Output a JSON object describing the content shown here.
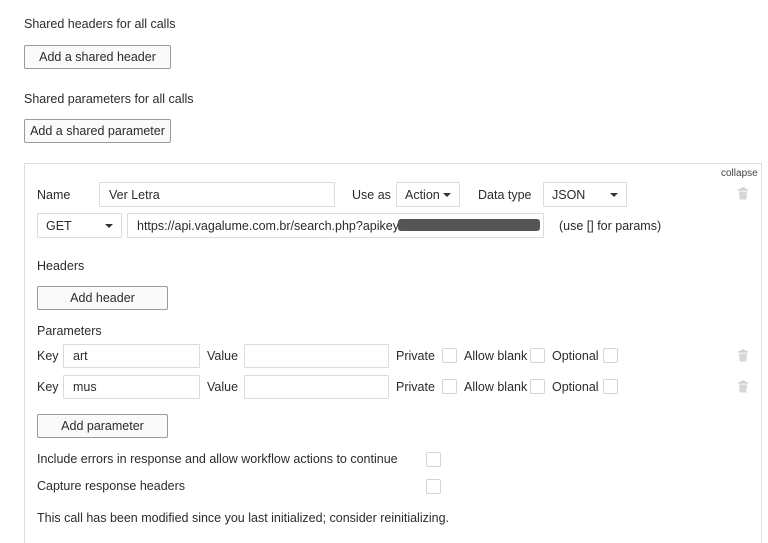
{
  "shared_headers": {
    "title": "Shared headers for all calls",
    "add_button": "Add a shared header"
  },
  "shared_params": {
    "title": "Shared parameters for all calls",
    "add_button": "Add a shared parameter"
  },
  "call": {
    "collapse_label": "collapse",
    "name_label": "Name",
    "name_value": "Ver Letra",
    "use_as_label": "Use as",
    "use_as_value": "Action",
    "data_type_label": "Data type",
    "data_type_value": "JSON",
    "method_value": "GET",
    "url_value": "https://api.vagalume.com.br/search.php?apikey=",
    "url_hint": "(use [] for params)",
    "headers_title": "Headers",
    "add_header_button": "Add header",
    "parameters_title": "Parameters",
    "parameters": [
      {
        "key_label": "Key",
        "key_value": "art",
        "value_label": "Value",
        "value_value": "",
        "private_label": "Private",
        "allow_blank_label": "Allow blank",
        "optional_label": "Optional"
      },
      {
        "key_label": "Key",
        "key_value": "mus",
        "value_label": "Value",
        "value_value": "",
        "private_label": "Private",
        "allow_blank_label": "Allow blank",
        "optional_label": "Optional"
      }
    ],
    "add_parameter_button": "Add parameter",
    "include_errors_label": "Include errors in response and allow workflow actions to continue",
    "capture_headers_label": "Capture response headers",
    "modified_notice": "This call has been modified since you last initialized; consider reinitializing."
  },
  "icons": {
    "trash": "trash-icon",
    "caret": "caret-down-icon"
  }
}
